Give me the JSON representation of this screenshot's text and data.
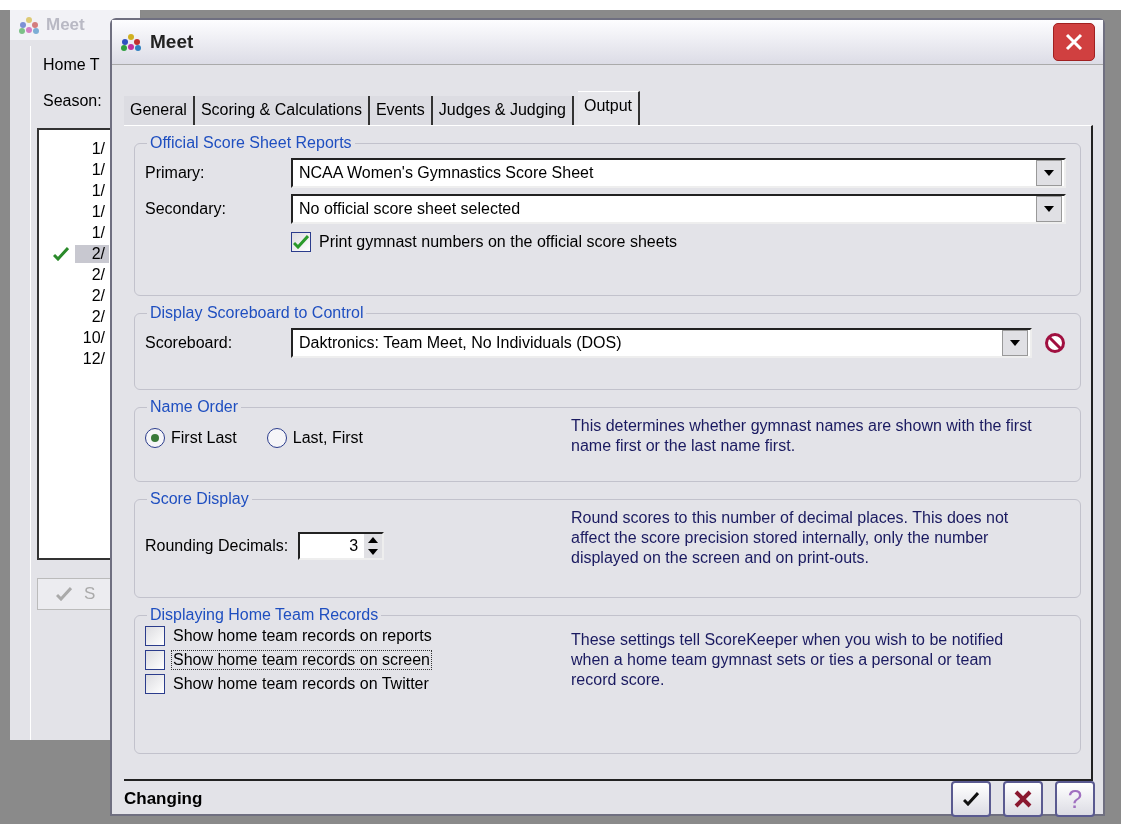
{
  "background_window": {
    "title": "Meet",
    "labels": [
      "Home T",
      "Season:"
    ],
    "list": [
      {
        "text": "1/",
        "selected": false,
        "checked": false
      },
      {
        "text": "1/",
        "selected": false,
        "checked": false
      },
      {
        "text": "1/",
        "selected": false,
        "checked": false
      },
      {
        "text": "1/",
        "selected": false,
        "checked": false
      },
      {
        "text": "1/",
        "selected": false,
        "checked": false
      },
      {
        "text": "2/",
        "selected": true,
        "checked": true
      },
      {
        "text": "2/",
        "selected": false,
        "checked": false
      },
      {
        "text": "2/",
        "selected": false,
        "checked": false
      },
      {
        "text": "2/",
        "selected": false,
        "checked": false
      },
      {
        "text": "10/",
        "selected": false,
        "checked": false
      },
      {
        "text": "12/",
        "selected": false,
        "checked": false
      }
    ],
    "button": {
      "label": "S",
      "disabled": true
    }
  },
  "dialog": {
    "title": "Meet",
    "tabs": [
      {
        "label": "General",
        "selected": false
      },
      {
        "label": "Scoring & Calculations",
        "selected": false
      },
      {
        "label": "Events",
        "selected": false
      },
      {
        "label": "Judges & Judging",
        "selected": false
      },
      {
        "label": "Output",
        "selected": true
      }
    ],
    "sections": [
      {
        "kind": "reports",
        "title": "Official Score Sheet Reports",
        "fields": [
          {
            "label": "Primary:",
            "value": "NCAA Women's Gymnastics Score Sheet"
          },
          {
            "label": "Secondary:",
            "value": "No official score sheet selected"
          }
        ],
        "checkbox": {
          "label": "Print gymnast numbers on the official score sheets",
          "checked": true
        }
      },
      {
        "kind": "scoreboard",
        "title": "Display Scoreboard to Control",
        "fields": [
          {
            "label": "Scoreboard:",
            "value": "Daktronics: Team Meet, No Individuals (DOS)"
          }
        ]
      },
      {
        "kind": "name_order",
        "title": "Name Order",
        "radios": [
          {
            "label": "First Last",
            "selected": true
          },
          {
            "label": "Last, First",
            "selected": false
          }
        ],
        "note": "This determines whether gymnast names are shown with the first name first or the last name first."
      },
      {
        "kind": "score_display",
        "title": "Score Display",
        "spinner": {
          "label": "Rounding Decimals:",
          "value": "3"
        },
        "note": "Round scores to this number of decimal places.  This does not affect the score precision stored internally, only the number displayed on the screen and on print-outs."
      },
      {
        "kind": "records",
        "title": "Displaying Home Team Records",
        "checkboxes": [
          {
            "label": "Show home team records on reports",
            "checked": false,
            "focused": false
          },
          {
            "label": "Show home team records on screen",
            "checked": false,
            "focused": true
          },
          {
            "label": "Show home team records on Twitter",
            "checked": false,
            "focused": false
          }
        ],
        "note": "These settings tell ScoreKeeper when you wish to be notified when a home team gymnast sets or ties a personal or team record score."
      }
    ],
    "status": "Changing",
    "buttons": [
      {
        "kind": "ok"
      },
      {
        "kind": "cancel"
      },
      {
        "kind": "help",
        "label": "?"
      }
    ]
  }
}
